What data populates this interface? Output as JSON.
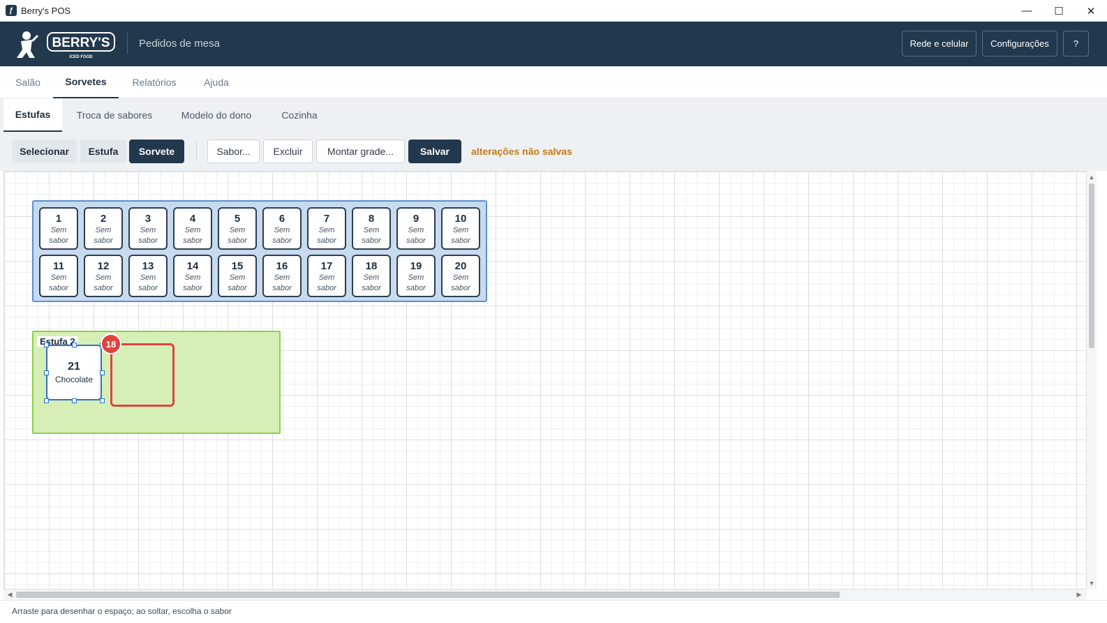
{
  "window": {
    "title": "Berry's POS"
  },
  "header": {
    "logo_text": "BERRY'S",
    "logo_subtext": "ICED FOOD",
    "subtitle": "Pedidos de mesa",
    "buttons": {
      "network": "Rede e celular",
      "settings": "Configurações",
      "help": "?"
    }
  },
  "main_tabs": [
    {
      "label": "Salão",
      "active": false
    },
    {
      "label": "Sorvetes",
      "active": true
    },
    {
      "label": "Relatórios",
      "active": false
    },
    {
      "label": "Ajuda",
      "active": false
    }
  ],
  "sub_tabs": [
    {
      "label": "Estufas",
      "active": true
    },
    {
      "label": "Troca de sabores",
      "active": false
    },
    {
      "label": "Modelo do dono",
      "active": false
    },
    {
      "label": "Cozinha",
      "active": false
    }
  ],
  "toolbar": {
    "mode_select": "Selecionar",
    "mode_estufa": "Estufa",
    "mode_sorvete": "Sorvete",
    "active_mode": "Sorvete",
    "flavor": "Sabor...",
    "delete": "Excluir",
    "grid": "Montar grade...",
    "save": "Salvar",
    "unsaved_notice": "alterações não salvas"
  },
  "estufa1": {
    "empty_label": "Sem sabor",
    "slots": [
      {
        "num": "1",
        "label": "Sem sabor"
      },
      {
        "num": "2",
        "label": "Sem sabor"
      },
      {
        "num": "3",
        "label": "Sem sabor"
      },
      {
        "num": "4",
        "label": "Sem sabor"
      },
      {
        "num": "5",
        "label": "Sem sabor"
      },
      {
        "num": "6",
        "label": "Sem sabor"
      },
      {
        "num": "7",
        "label": "Sem sabor"
      },
      {
        "num": "8",
        "label": "Sem sabor"
      },
      {
        "num": "9",
        "label": "Sem sabor"
      },
      {
        "num": "10",
        "label": "Sem sabor"
      },
      {
        "num": "11",
        "label": "Sem sabor"
      },
      {
        "num": "12",
        "label": "Sem sabor"
      },
      {
        "num": "13",
        "label": "Sem sabor"
      },
      {
        "num": "14",
        "label": "Sem sabor"
      },
      {
        "num": "15",
        "label": "Sem sabor"
      },
      {
        "num": "16",
        "label": "Sem sabor"
      },
      {
        "num": "17",
        "label": "Sem sabor"
      },
      {
        "num": "18",
        "label": "Sem sabor"
      },
      {
        "num": "19",
        "label": "Sem sabor"
      },
      {
        "num": "20",
        "label": "Sem sabor"
      }
    ]
  },
  "estufa2": {
    "label": "Estufa 2",
    "selected_slot": {
      "num": "21",
      "label": "Chocolate"
    },
    "drawing_badge": "18"
  },
  "status": {
    "message": "Arraste para desenhar o espaço; ao soltar, escolha o sabor"
  },
  "colors": {
    "header_bg": "#22384d",
    "estufa1_fill": "#c8daef",
    "estufa2_fill": "#d6efb6",
    "unsaved": "#c47a16",
    "draw_rect": "#e0423f"
  }
}
